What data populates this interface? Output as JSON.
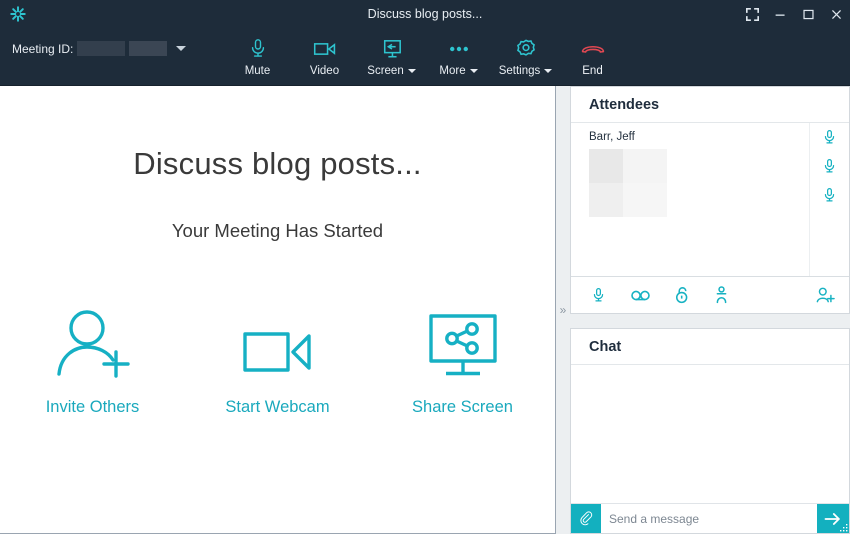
{
  "window": {
    "title": "Discuss blog posts...",
    "logo_icon": "asterisk-logo-icon",
    "controls": [
      {
        "name": "fullscreen",
        "icon": "fullscreen-icon"
      },
      {
        "name": "minimize",
        "icon": "minimize-icon"
      },
      {
        "name": "maximize",
        "icon": "maximize-icon"
      },
      {
        "name": "close",
        "icon": "close-icon"
      }
    ]
  },
  "toolbar": {
    "meeting_id_label": "Meeting ID:",
    "meeting_id_value": "",
    "meeting_id_redacted": true,
    "dropdown_icon": "chevron-down-icon",
    "buttons": [
      {
        "label": "Mute",
        "icon": "microphone-icon",
        "has_caret": false
      },
      {
        "label": "Video",
        "icon": "video-camera-icon",
        "has_caret": false
      },
      {
        "label": "Screen",
        "icon": "screen-share-icon",
        "has_caret": true
      },
      {
        "label": "More",
        "icon": "ellipsis-icon",
        "has_caret": true
      },
      {
        "label": "Settings",
        "icon": "gear-icon",
        "has_caret": true
      },
      {
        "label": "End",
        "icon": "hangup-phone-icon",
        "has_caret": false
      }
    ]
  },
  "stage": {
    "title": "Discuss blog posts...",
    "subtitle": "Your Meeting Has Started",
    "actions": [
      {
        "label": "Invite Others",
        "icon": "person-add-icon"
      },
      {
        "label": "Start Webcam",
        "icon": "video-camera-icon"
      },
      {
        "label": "Share Screen",
        "icon": "monitor-share-icon"
      }
    ]
  },
  "sidebar": {
    "collapse_icon": "double-chevron-right-icon",
    "attendees": {
      "title": "Attendees",
      "list": [
        {
          "name": "Barr, Jeff",
          "redacted": true
        }
      ],
      "mic_indicators": [
        "microphone-icon",
        "microphone-icon",
        "microphone-icon"
      ],
      "toolbar": [
        {
          "name": "mute-all",
          "icon": "microphone-icon"
        },
        {
          "name": "recording",
          "icon": "recording-icon"
        },
        {
          "name": "lock-meeting",
          "icon": "unlock-icon"
        },
        {
          "name": "presenter",
          "icon": "presenter-person-icon"
        },
        {
          "name": "add-attendee",
          "icon": "person-add-icon"
        }
      ]
    },
    "chat": {
      "title": "Chat",
      "messages": [],
      "attach_icon": "paperclip-icon",
      "input_value": "",
      "input_placeholder": "Send a message",
      "send_icon": "arrow-right-icon"
    }
  },
  "colors": {
    "chrome": "#1e2c3a",
    "accent_teal": "#16b0c4",
    "end_red": "#e04852",
    "panel_bg": "#eceff1",
    "stage_bg": "#ffffff"
  }
}
